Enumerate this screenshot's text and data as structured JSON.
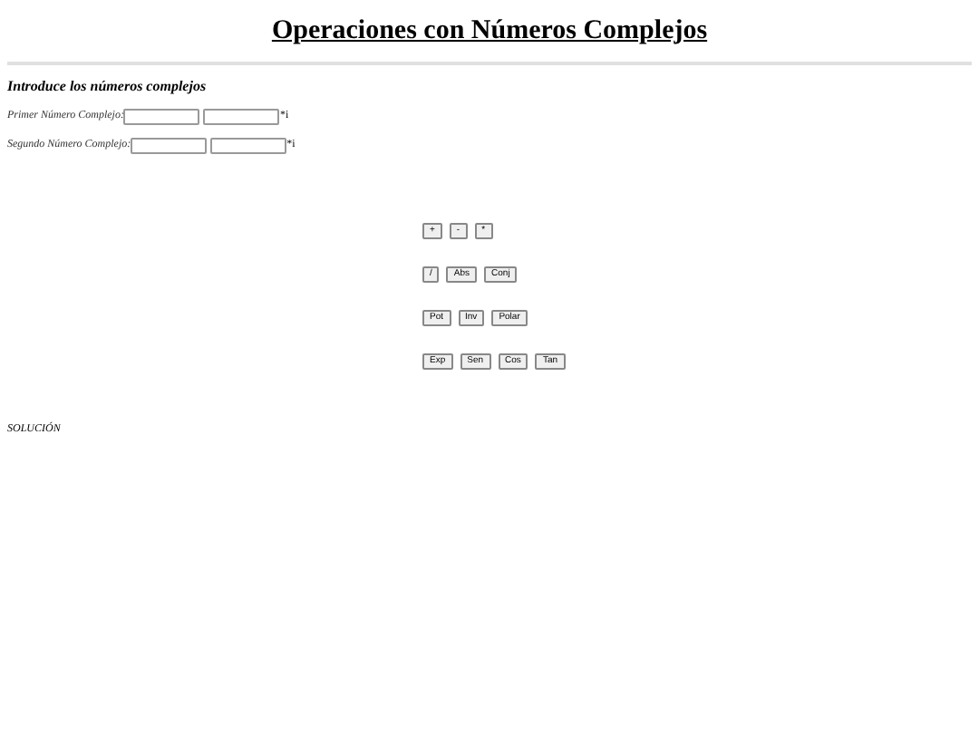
{
  "title": "Operaciones con Números Complejos",
  "form": {
    "heading": "Introduce los números complejos",
    "rows": [
      {
        "label": "Primer Número Complejo:",
        "suffix": "*i"
      },
      {
        "label": "Segundo Número Complejo:",
        "suffix": "*i"
      }
    ]
  },
  "button_rows": [
    [
      "+",
      "-",
      "*"
    ],
    [
      "/",
      "Abs",
      "Conj"
    ],
    [
      "Pot",
      "Inv",
      "Polar"
    ],
    [
      "Exp",
      "Sen",
      "Cos",
      "Tan"
    ]
  ],
  "solution_label": "SOLUCIÓN"
}
